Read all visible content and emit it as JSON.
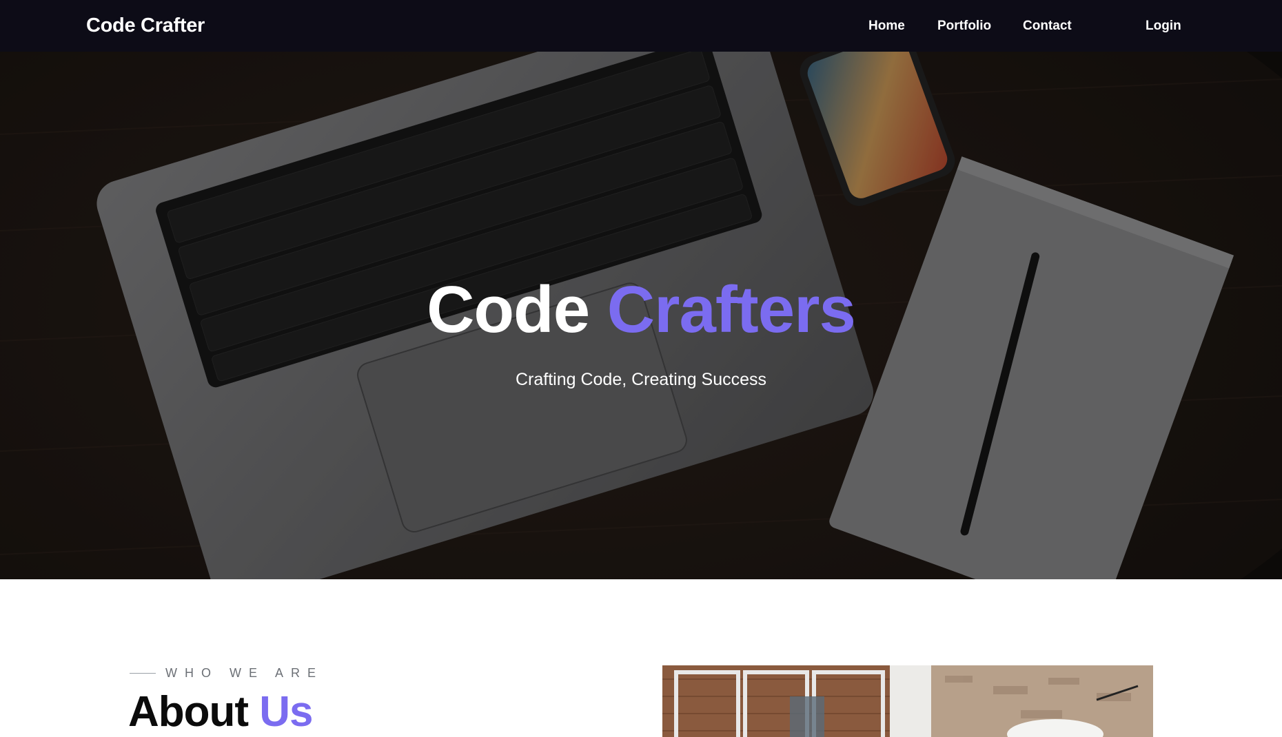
{
  "navbar": {
    "brand": "Code Crafter",
    "links": {
      "home": "Home",
      "portfolio": "Portfolio",
      "contact": "Contact",
      "login": "Login"
    }
  },
  "hero": {
    "title_part1": "Code",
    "title_part2": "Crafters",
    "subtitle": "Crafting Code, Creating Success"
  },
  "about": {
    "eyebrow": "WHO WE ARE",
    "title_part1": "About",
    "title_part2": "Us"
  },
  "colors": {
    "navbar_bg": "#0d0c17",
    "accent": "#7b6cf0",
    "text_dark": "#0b0b0b"
  }
}
